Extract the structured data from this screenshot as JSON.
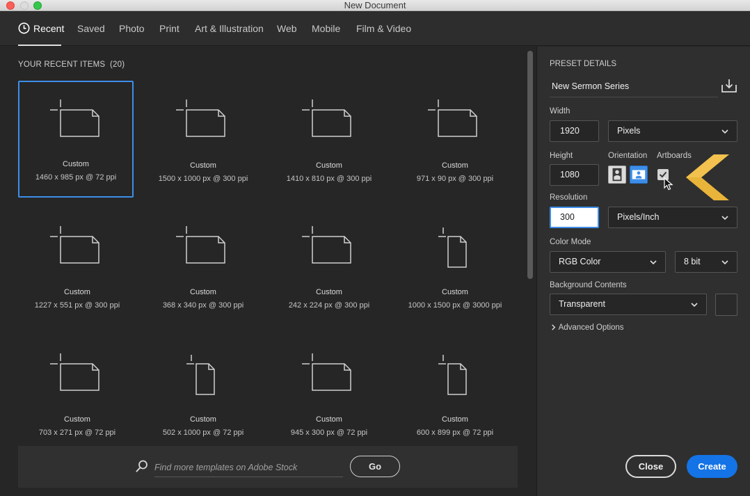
{
  "window": {
    "title": "New Document"
  },
  "tabs": [
    {
      "label": "Recent",
      "active": true,
      "icon": "clock-icon"
    },
    {
      "label": "Saved"
    },
    {
      "label": "Photo"
    },
    {
      "label": "Print"
    },
    {
      "label": "Art & Illustration"
    },
    {
      "label": "Web"
    },
    {
      "label": "Mobile"
    },
    {
      "label": "Film & Video"
    }
  ],
  "recent": {
    "heading": "YOUR RECENT ITEMS",
    "count": "(20)",
    "items": [
      {
        "name": "Custom",
        "dims": "1460 x 985 px @ 72 ppi",
        "selected": true,
        "icon": "landscape-document-icon"
      },
      {
        "name": "Custom",
        "dims": "1500 x 1000 px @ 300 ppi",
        "icon": "landscape-document-icon"
      },
      {
        "name": "Custom",
        "dims": "1410 x 810 px @ 300 ppi",
        "icon": "landscape-document-icon"
      },
      {
        "name": "Custom",
        "dims": "971 x 90 px @ 300 ppi",
        "icon": "landscape-document-icon"
      },
      {
        "name": "Custom",
        "dims": "1227 x 551 px @ 300 ppi",
        "icon": "landscape-document-icon"
      },
      {
        "name": "Custom",
        "dims": "368 x 340 px @ 300 ppi",
        "icon": "landscape-document-icon"
      },
      {
        "name": "Custom",
        "dims": "242 x 224 px @ 300 ppi",
        "icon": "landscape-document-icon"
      },
      {
        "name": "Custom",
        "dims": "1000 x 1500 px @ 3000 ppi",
        "icon": "portrait-document-icon"
      },
      {
        "name": "Custom",
        "dims": "703 x 271 px @ 72 ppi",
        "icon": "landscape-document-icon"
      },
      {
        "name": "Custom",
        "dims": "502 x 1000 px @ 72 ppi",
        "icon": "portrait-document-icon"
      },
      {
        "name": "Custom",
        "dims": "945 x 300 px @ 72 ppi",
        "icon": "landscape-document-icon"
      },
      {
        "name": "Custom",
        "dims": "600 x 899 px @ 72 ppi",
        "icon": "portrait-document-icon"
      }
    ]
  },
  "stock": {
    "placeholder": "Find more templates on Adobe Stock",
    "go_label": "Go"
  },
  "preset": {
    "section_label": "PRESET DETAILS",
    "name": "New Sermon Series",
    "width_label": "Width",
    "width_value": "1920",
    "width_unit": "Pixels",
    "height_label": "Height",
    "height_value": "1080",
    "orientation_label": "Orientation",
    "orientation_selected": "landscape",
    "artboards_label": "Artboards",
    "artboards_checked": true,
    "resolution_label": "Resolution",
    "resolution_value": "300",
    "resolution_unit": "Pixels/Inch",
    "color_mode_label": "Color Mode",
    "color_mode": "RGB Color",
    "bit_depth": "8 bit",
    "background_label": "Background Contents",
    "background": "Transparent",
    "advanced_label": "Advanced Options"
  },
  "actions": {
    "close_label": "Close",
    "create_label": "Create"
  },
  "colors": {
    "accent": "#1473e6",
    "selection": "#3d8ee9",
    "chevron_logo": "#e9b43a"
  }
}
